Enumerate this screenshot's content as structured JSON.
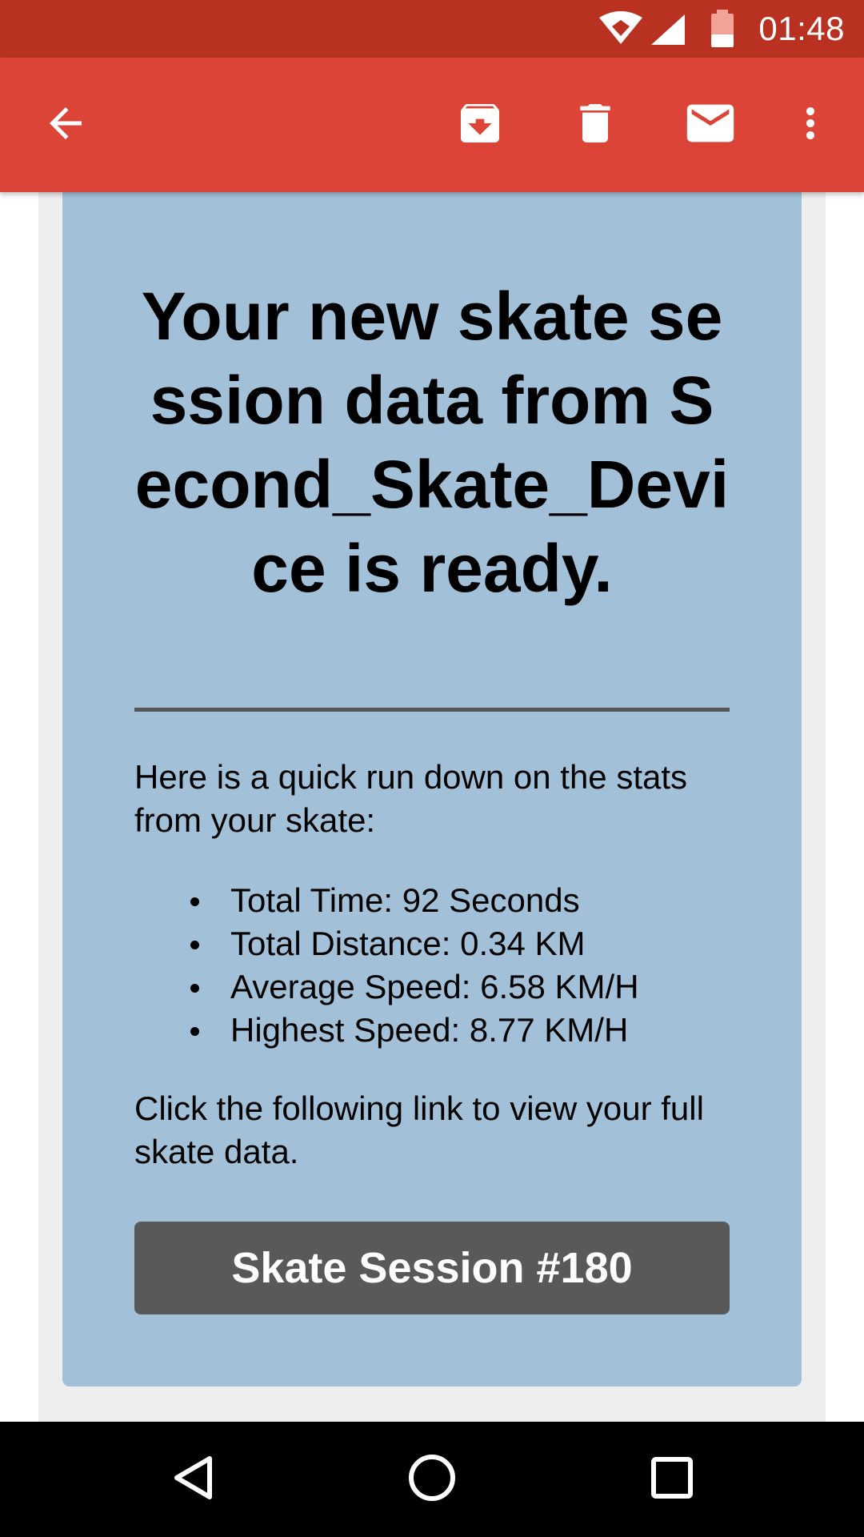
{
  "status_bar": {
    "time": "01:48",
    "icons": [
      "wifi-icon",
      "cell-signal-icon",
      "battery-icon"
    ]
  },
  "app_bar": {
    "actions": [
      "back-arrow-icon",
      "archive-icon",
      "delete-icon",
      "mark-unread-icon",
      "more-vert-icon"
    ]
  },
  "email": {
    "headline": "Your new skate session data from Second_Skate_Device is ready.",
    "intro": "Here is a quick run down on the stats from your skate:",
    "stats": [
      "Total Time: 92 Seconds",
      "Total Distance: 0.34 KM",
      "Average Speed: 6.58 KM/H",
      "Highest Speed: 8.77 KM/H"
    ],
    "cta_text": "Click the following link to view your full skate data.",
    "cta_button": "Skate Session #180"
  },
  "nav_bar": {
    "buttons": [
      "back-triangle-icon",
      "home-circle-icon",
      "recents-square-icon"
    ]
  },
  "colors": {
    "status_bar": "#b93221",
    "app_bar": "#db4437",
    "card": "#a2c1d8",
    "button": "#595959",
    "divider": "#555555"
  }
}
